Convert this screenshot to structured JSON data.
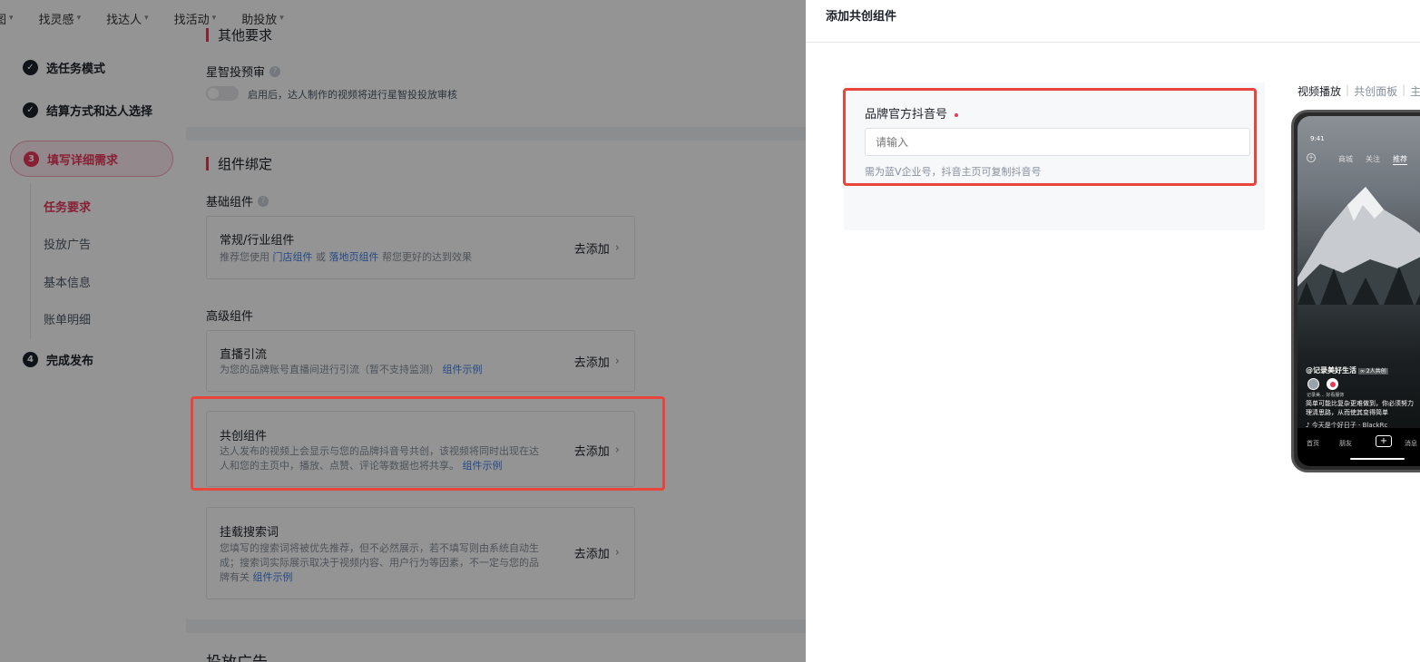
{
  "topnav": {
    "items": [
      "图",
      "找灵感",
      "找达人",
      "找活动",
      "助投放"
    ]
  },
  "steps": {
    "step1": "选任务模式",
    "step2": "结算方式和达人选择",
    "step3_num": "3",
    "step3": "填写详细需求",
    "sub": [
      "任务要求",
      "投放广告",
      "基本信息",
      "账单明细"
    ],
    "step4_num": "4",
    "step4": "完成发布"
  },
  "main": {
    "partial_heading": "其他要求",
    "xingzhi_label": "星智投预审",
    "xingzhi_toggle_text": "启用后，达人制作的视频将进行星智投投放审核",
    "section_title": "组件绑定",
    "basic_label": "基础组件",
    "advanced_label": "高级组件",
    "bottom_heading": "投放广告",
    "components": [
      {
        "title": "常规/行业组件",
        "desc_pre": "推荐您使用",
        "link1": "门店组件",
        "mid": "或",
        "link2": "落地页组件",
        "desc_post": "帮您更好的达到效果",
        "add": "去添加"
      },
      {
        "title": "直播引流",
        "desc": "为您的品牌账号直播间进行引流（暂不支持监测）",
        "link": "组件示例",
        "add": "去添加"
      },
      {
        "title": "共创组件",
        "desc1": "达人发布的视频上会显示与您的品牌抖音号共创，该视频将同时出现在达",
        "desc2": "人和您的主页中，播放、点赞、评论等数据也将共享。",
        "link": "组件示例",
        "add": "去添加"
      },
      {
        "title": "挂载搜索词",
        "desc1": "您填写的搜索词将被优先推荐，但不必然展示，若不填写则由系统自动生",
        "desc2": "成；搜索词实际展示取决于视频内容、用户行为等因素，不一定与您的品",
        "desc3": "牌有关",
        "link": "组件示例",
        "add": "去添加"
      }
    ]
  },
  "drawer": {
    "title": "添加共创组件",
    "field_label": "品牌官方抖音号",
    "field_placeholder": "请输入",
    "field_hint": "需为蓝V企业号，抖音主页可复制抖音号",
    "preview_tabs": [
      "视频播放",
      "共创面板",
      "主"
    ],
    "phone": {
      "time": "9:41",
      "top_tabs": [
        "商城",
        "关注",
        "推荐"
      ],
      "user": "@记录美好生活",
      "user_tag": "∞ 2人共创",
      "avatar_names": "记录美...  好看服饰",
      "desc1": "简单可能比复杂更难做到，你必须努力",
      "desc2": "理清思路，从而使其变得简单",
      "music": "♪ 今天是个好日子 - BlackRc",
      "bottom": [
        "首页",
        "朋友",
        "消息"
      ]
    }
  },
  "colors": {
    "accent": "#e8385b",
    "highlight": "#e8453c",
    "link": "#3f7ee8"
  }
}
